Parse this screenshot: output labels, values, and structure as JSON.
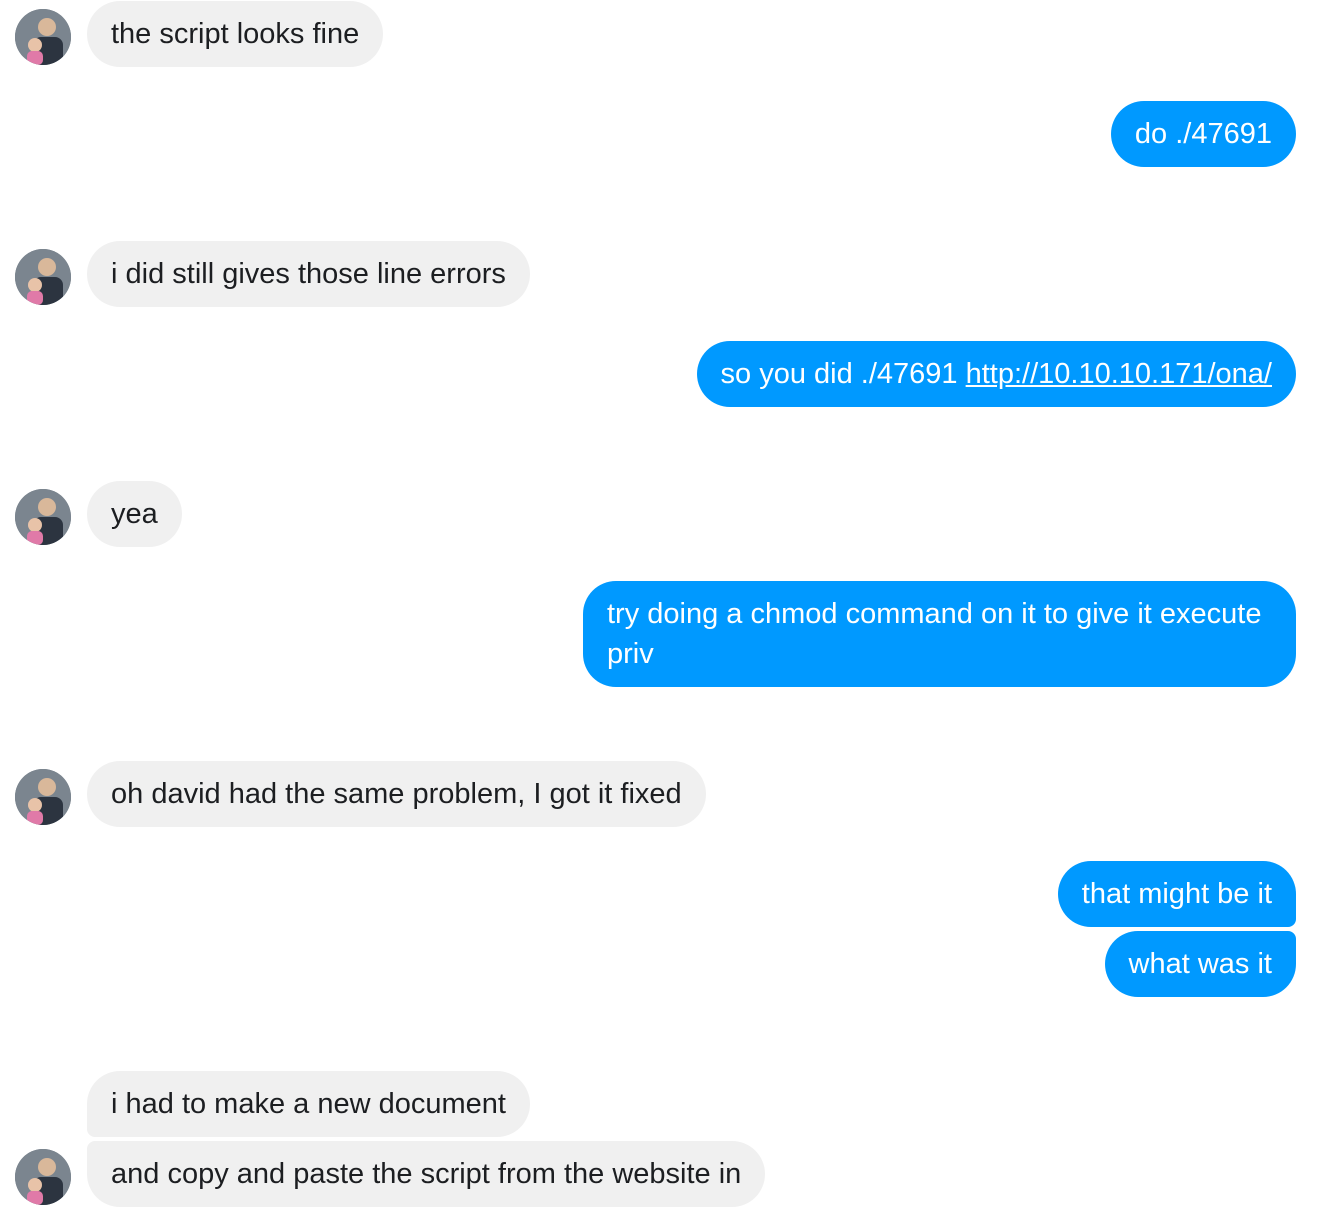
{
  "conversation": {
    "messages": [
      {
        "text": "the script looks fine"
      },
      {
        "text": "do ./47691"
      },
      {
        "text": "i did still gives those line errors"
      },
      {
        "text": "so you did ./47691 ",
        "link": "http://10.10.10.171/ona/"
      },
      {
        "text": "yea"
      },
      {
        "text": "try doing a chmod command on it to give it execute priv"
      },
      {
        "text": "oh david had the same problem, I got it fixed"
      },
      {
        "text": "that might be it"
      },
      {
        "text": "what was it"
      },
      {
        "text": "i had to make a new document"
      },
      {
        "text": "and copy and paste the script from the website in"
      }
    ]
  },
  "colors": {
    "incoming_bubble": "#f0f0f0",
    "outgoing_bubble": "#0099ff",
    "incoming_text": "#1c1e21",
    "outgoing_text": "#ffffff"
  },
  "icons": {
    "contact_avatar": "avatar-photo"
  }
}
